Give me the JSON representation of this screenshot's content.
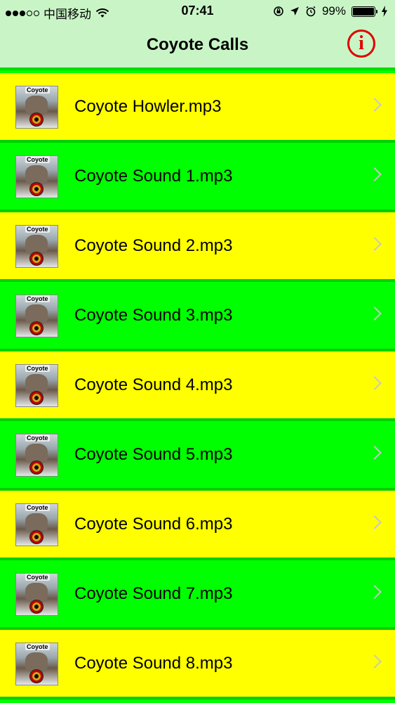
{
  "status_bar": {
    "carrier": "中国移动",
    "time": "07:41",
    "battery_percent": "99%",
    "battery_level": 0.99,
    "icons": [
      "signal-dots-icon",
      "wifi-icon",
      "rotation-lock-icon",
      "location-arrow-icon",
      "alarm-icon",
      "battery-icon",
      "charging-bolt-icon"
    ]
  },
  "nav": {
    "title": "Coyote Calls",
    "info_glyph": "i",
    "info_color": "#e00000"
  },
  "thumbnail": {
    "label": "Coyote"
  },
  "colors": {
    "yellow_row": "#ffff00",
    "green_row": "#00ff00",
    "nav_background": "#c9f5c6"
  },
  "sounds": [
    {
      "label": "Coyote Howler.mp3",
      "color": "yellow"
    },
    {
      "label": "Coyote Sound 1.mp3",
      "color": "green"
    },
    {
      "label": "Coyote Sound 2.mp3",
      "color": "yellow"
    },
    {
      "label": "Coyote Sound 3.mp3",
      "color": "green"
    },
    {
      "label": "Coyote Sound 4.mp3",
      "color": "yellow"
    },
    {
      "label": "Coyote Sound 5.mp3",
      "color": "green"
    },
    {
      "label": "Coyote Sound 6.mp3",
      "color": "yellow"
    },
    {
      "label": "Coyote Sound 7.mp3",
      "color": "green"
    },
    {
      "label": "Coyote Sound 8.mp3",
      "color": "yellow"
    }
  ]
}
